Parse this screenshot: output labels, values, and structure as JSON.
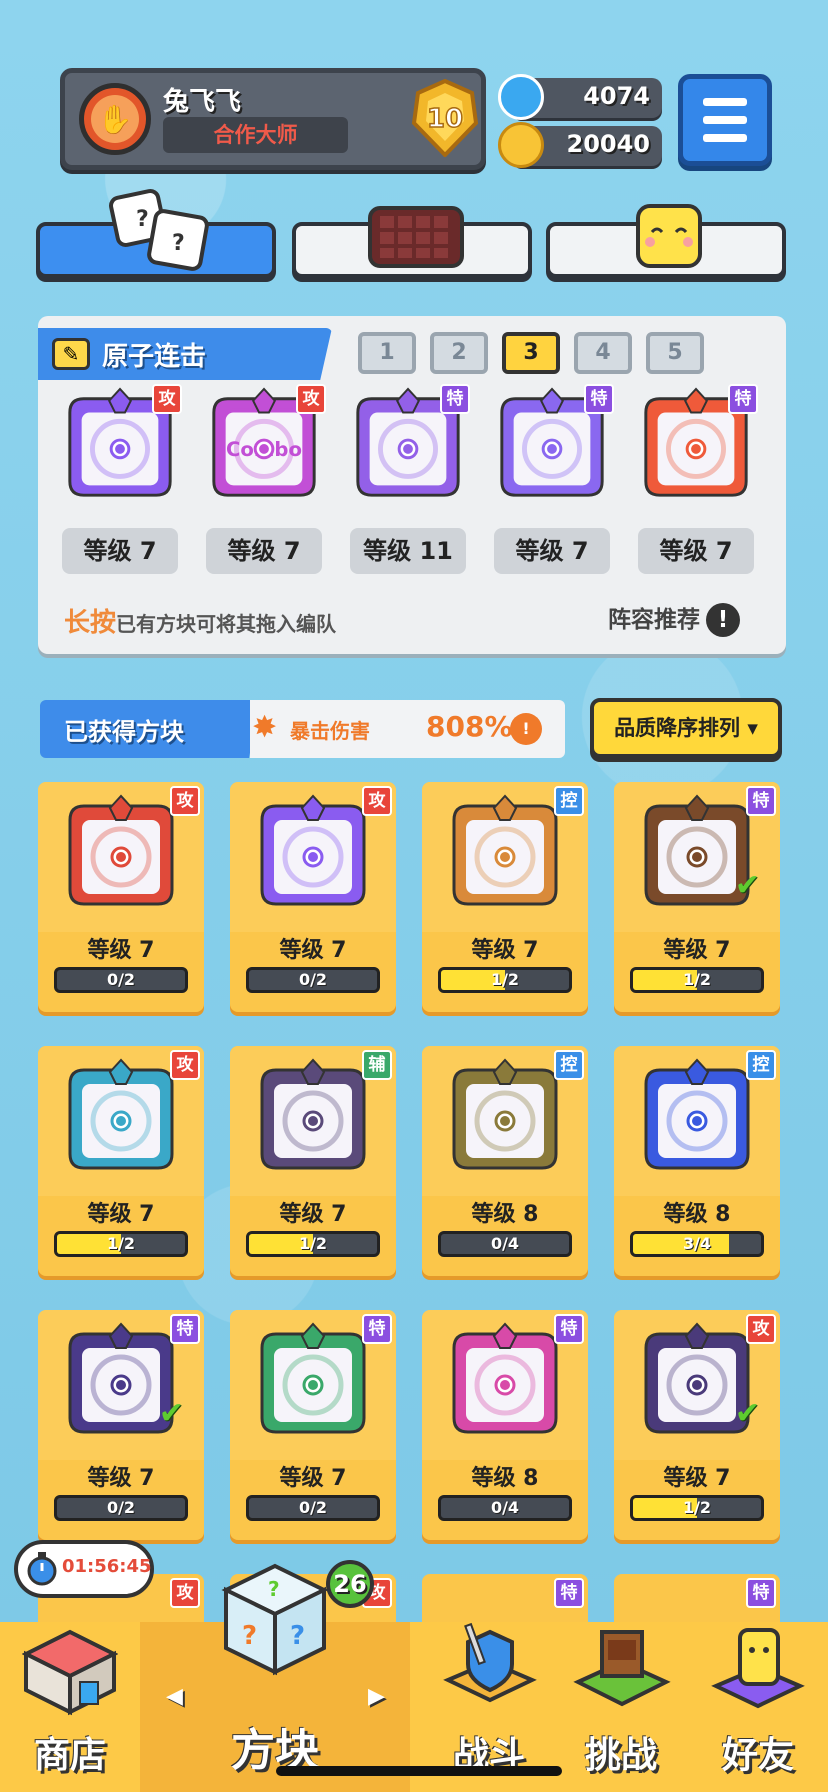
{
  "player": {
    "name": "兔飞飞",
    "title": "合作大师",
    "rank": "10"
  },
  "currency": {
    "gems": "4074",
    "coins": "20040"
  },
  "loadout": {
    "name": "原子连击",
    "slots": [
      "1",
      "2",
      "3",
      "4",
      "5"
    ],
    "selected_slot": 2,
    "blocks": [
      {
        "level": "等级 7",
        "tag": "攻",
        "tag_color": "#e8453a",
        "color": "#8b5cf0"
      },
      {
        "level": "等级 7",
        "tag": "攻",
        "tag_color": "#e8453a",
        "color": "#c24fd6",
        "text": "Combo"
      },
      {
        "level": "等级 11",
        "tag": "特",
        "tag_color": "#8b4fe0",
        "color": "#9360e8"
      },
      {
        "level": "等级 7",
        "tag": "特",
        "tag_color": "#8b4fe0",
        "color": "#8a68f0"
      },
      {
        "level": "等级 7",
        "tag": "特",
        "tag_color": "#8b4fe0",
        "color": "#ef5a3a"
      }
    ],
    "hint_strong": "长按",
    "hint_rest": "已有方块可将其拖入编队",
    "recommend": "阵容推荐",
    "recommend_icon": "!"
  },
  "obtained": {
    "title": "已获得方块",
    "crit_label": "暴击伤害",
    "crit_value": "808%",
    "crit_icon": "!",
    "sort_label": "品质降序排列 ▾"
  },
  "cards": [
    {
      "level": "等级 7",
      "progress": "0/2",
      "fill": 0,
      "tag": "攻",
      "tag_color": "#e8453a",
      "color": "#e04a3a",
      "equipped": false
    },
    {
      "level": "等级 7",
      "progress": "0/2",
      "fill": 0,
      "tag": "攻",
      "tag_color": "#e8453a",
      "color": "#8a5cf0",
      "equipped": false
    },
    {
      "level": "等级 7",
      "progress": "1/2",
      "fill": 0.5,
      "tag": "控",
      "tag_color": "#3a8fe8",
      "color": "#d98a3a",
      "equipped": false
    },
    {
      "level": "等级 7",
      "progress": "1/2",
      "fill": 0.5,
      "tag": "特",
      "tag_color": "#8b4fe0",
      "color": "#7a4a2a",
      "equipped": true
    },
    {
      "level": "等级 7",
      "progress": "1/2",
      "fill": 0.5,
      "tag": "攻",
      "tag_color": "#e8453a",
      "color": "#3aa8c8",
      "equipped": false
    },
    {
      "level": "等级 7",
      "progress": "1/2",
      "fill": 0.5,
      "tag": "辅",
      "tag_color": "#3aa86a",
      "color": "#5a4a7a",
      "equipped": false
    },
    {
      "level": "等级 8",
      "progress": "0/4",
      "fill": 0,
      "tag": "控",
      "tag_color": "#3a8fe8",
      "color": "#8a7a3a",
      "equipped": false
    },
    {
      "level": "等级 8",
      "progress": "3/4",
      "fill": 0.75,
      "tag": "控",
      "tag_color": "#3a8fe8",
      "color": "#3a5ae0",
      "equipped": false
    },
    {
      "level": "等级 7",
      "progress": "0/2",
      "fill": 0,
      "tag": "特",
      "tag_color": "#8b4fe0",
      "color": "#4a3a8a",
      "equipped": true
    },
    {
      "level": "等级 7",
      "progress": "0/2",
      "fill": 0,
      "tag": "特",
      "tag_color": "#8b4fe0",
      "color": "#3aa86a",
      "equipped": false
    },
    {
      "level": "等级 8",
      "progress": "0/4",
      "fill": 0,
      "tag": "特",
      "tag_color": "#8b4fe0",
      "color": "#d84aa8",
      "equipped": false
    },
    {
      "level": "等级 7",
      "progress": "1/2",
      "fill": 0.5,
      "tag": "攻",
      "tag_color": "#e8453a",
      "color": "#4a3a7a",
      "equipped": true
    }
  ],
  "peek_cards": [
    {
      "tag": "攻",
      "tag_color": "#e8453a"
    },
    {
      "tag": "攻",
      "tag_color": "#e8453a"
    },
    {
      "tag": "特",
      "tag_color": "#8b4fe0"
    },
    {
      "tag": "特",
      "tag_color": "#8b4fe0"
    }
  ],
  "timer": "01:56:45",
  "notification_count": "26",
  "nav": {
    "shop": "商店",
    "blocks": "方块",
    "battle": "战斗",
    "challenge": "挑战",
    "friends": "好友",
    "arrow_left": "◀",
    "arrow_right": "▶"
  }
}
